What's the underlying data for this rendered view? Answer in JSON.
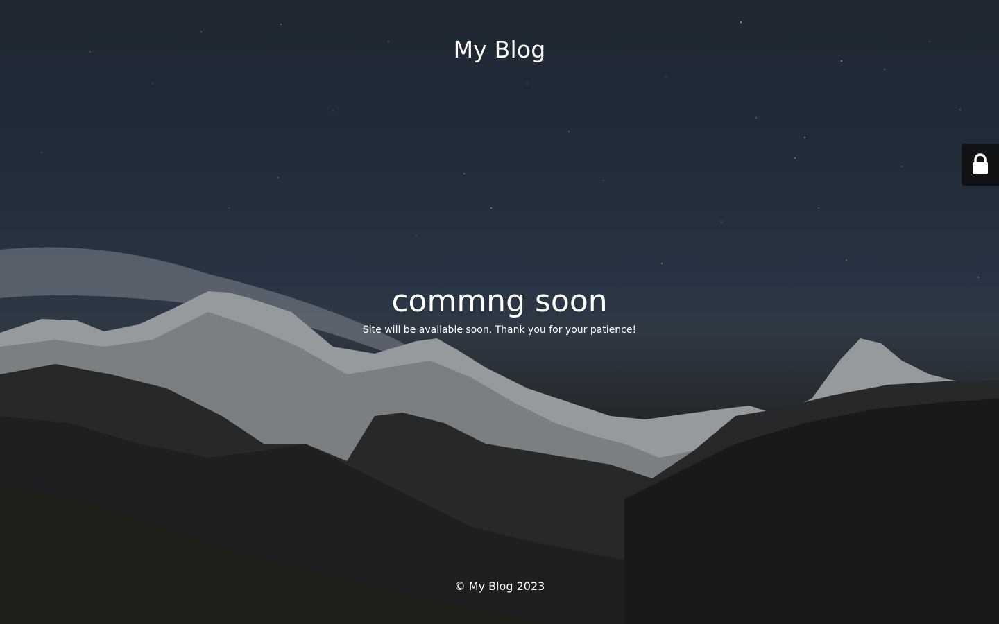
{
  "site": {
    "title": "My Blog"
  },
  "main": {
    "headline": "commng soon",
    "message": "Site will be available soon. Thank you for your patience!"
  },
  "footer": {
    "copyright": "© My Blog 2023"
  },
  "admin_tab": {
    "icon": "lock-icon"
  },
  "colors": {
    "text": "#ffffff",
    "lock_tab_bg": "#111213"
  }
}
